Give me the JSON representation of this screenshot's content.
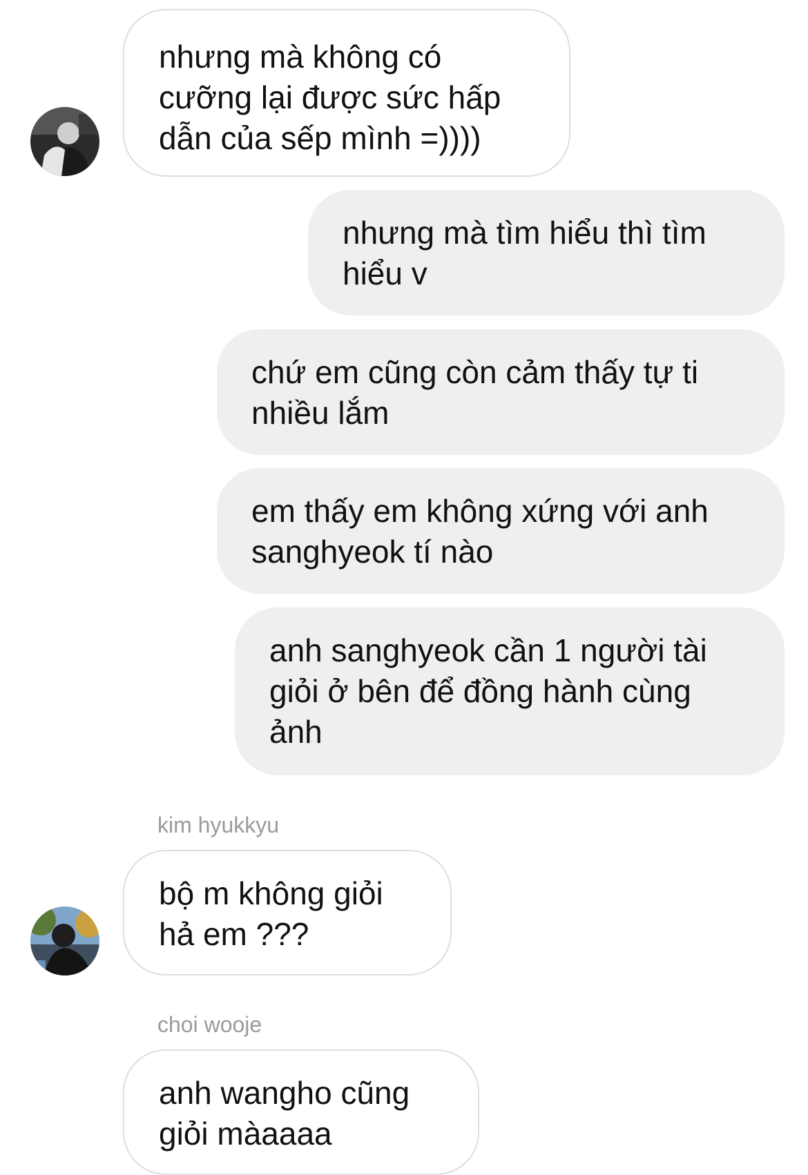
{
  "messages": [
    {
      "direction": "incoming",
      "text": "nhưng mà không có\ncưỡng lại được sức hấp\ndẫn của sếp mình =))))"
    },
    {
      "direction": "outgoing",
      "text": "nhưng mà tìm hiểu thì tìm\nhiểu v"
    },
    {
      "direction": "outgoing",
      "text": "chứ em cũng còn cảm thấy tự ti\nnhiều lắm"
    },
    {
      "direction": "outgoing",
      "text": "em thấy em không xứng với anh\nsanghyeok tí nào"
    },
    {
      "direction": "outgoing",
      "text": "anh sanghyeok cần 1 người tài\ngiỏi ở bên để đồng hành cùng\nảnh"
    },
    {
      "direction": "incoming",
      "sender": "kim hyukkyu",
      "text": "bộ m không giỏi\nhả em ???"
    },
    {
      "direction": "incoming",
      "sender": "choi wooje",
      "text": "anh wangho cũng\ngiỏi màaaaa"
    }
  ],
  "colors": {
    "incoming_bubble_border": "#dedede",
    "outgoing_bubble_fill": "#efefef",
    "sender_name": "#9a9a9a",
    "text": "#111111"
  },
  "icons": {
    "avatar_1": "user-photo-grayscale",
    "avatar_2": "user-photo-outdoor"
  }
}
